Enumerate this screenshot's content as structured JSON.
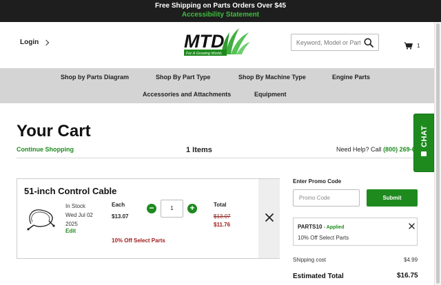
{
  "topbar": {
    "shipping_text": "Free Shipping on Parts Orders Over $45",
    "accessibility_link": "Accessibility Statement"
  },
  "header": {
    "login_label": "Login",
    "logo_text": "MTD",
    "logo_tagline": "For A Growing World.",
    "search_placeholder": "Keyword, Model or Part #",
    "cart_count": "1"
  },
  "nav": {
    "items": [
      "Shop by Parts Diagram",
      "Shop By Part Type",
      "Shop By Machine Type",
      "Engine Parts",
      "Accessories and Attachments",
      "Equipment"
    ]
  },
  "cart": {
    "title": "Your Cart",
    "continue_label": "Continue Shopping",
    "items_count": "1 Items",
    "help_prefix": "Need Help? Call",
    "help_phone": "(800) 269-621"
  },
  "chat": {
    "label": "CHAT"
  },
  "item": {
    "name": "51-inch Control Cable",
    "stock": "In Stock",
    "date_line1": "Wed Jul 02",
    "date_line2": "2025",
    "edit_label": "Edit",
    "each_label": "Each",
    "each_price": "$13.07",
    "quantity": "1",
    "total_label": "Total",
    "old_total": "$13.07",
    "new_total": "$11.76",
    "promo_note": "10% Off Select Parts"
  },
  "summary": {
    "promo_heading": "Enter Promo Code",
    "promo_placeholder": "Promo Code",
    "submit_label": "Submit",
    "applied_code": "PARTS10",
    "applied_status": "Applied",
    "applied_desc": "10% Off Select Parts",
    "shipping_label": "Shipping cost",
    "shipping_value": "$4.99",
    "estimated_label": "Estimated Total",
    "estimated_value": "$16.75"
  },
  "colors": {
    "brand_green": "#1e8a1e",
    "discount_red": "#a11a1a",
    "topbar_bg": "#1e1e1e",
    "nav_bg": "#d4d4d4"
  }
}
